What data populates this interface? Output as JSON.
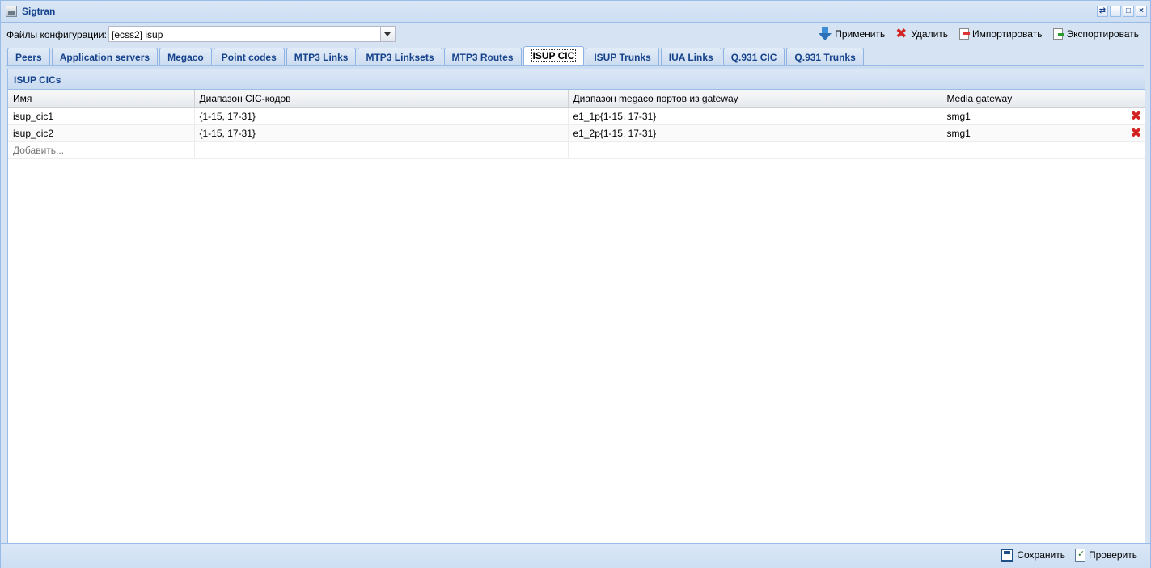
{
  "window": {
    "title": "Sigtran"
  },
  "config": {
    "label": "Файлы конфигурации:",
    "selected": "[ecss2] isup"
  },
  "actions": {
    "apply": "Применить",
    "delete": "Удалить",
    "import": "Импортировать",
    "export": "Экспортировать"
  },
  "tabs": [
    {
      "label": "Peers"
    },
    {
      "label": "Application servers"
    },
    {
      "label": "Megaco"
    },
    {
      "label": "Point codes"
    },
    {
      "label": "MTP3 Links"
    },
    {
      "label": "MTP3 Linksets"
    },
    {
      "label": "MTP3 Routes"
    },
    {
      "label": "ISUP CIC"
    },
    {
      "label": "ISUP Trunks"
    },
    {
      "label": "IUA Links"
    },
    {
      "label": "Q.931 CIC"
    },
    {
      "label": "Q.931 Trunks"
    }
  ],
  "active_tab": "ISUP CIC",
  "panel": {
    "title": "ISUP CICs"
  },
  "grid": {
    "columns": [
      "Имя",
      "Диапазон CIC-кодов",
      "Диапазон megaco портов из gateway",
      "Media gateway"
    ],
    "rows": [
      [
        "isup_cic1",
        "{1-15, 17-31}",
        "e1_1p{1-15, 17-31}",
        "smg1"
      ],
      [
        "isup_cic2",
        "{1-15, 17-31}",
        "e1_2p{1-15, 17-31}",
        "smg1"
      ]
    ],
    "add_placeholder": "Добавить..."
  },
  "footer": {
    "save": "Сохранить",
    "check": "Проверить"
  },
  "colors": {
    "header_text": "#15428b",
    "border": "#99bbe8",
    "delete_red": "#d32222"
  }
}
